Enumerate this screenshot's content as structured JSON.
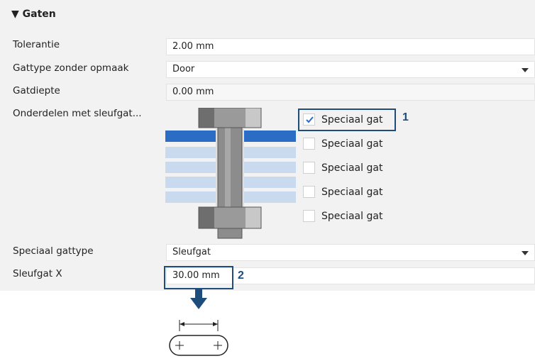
{
  "section": {
    "title": "▼ Gaten"
  },
  "rows": {
    "tolerance": {
      "label": "Tolerantie",
      "value": "2.00 mm"
    },
    "hole_type": {
      "label": "Gattype zonder opmaak",
      "value": "Door"
    },
    "hole_depth": {
      "label": "Gatdiepte",
      "value": "0.00 mm"
    },
    "slotted_parts": {
      "label": "Onderdelen met sleufgat..."
    },
    "special_hole_type": {
      "label": "Speciaal gattype",
      "value": "Sleufgat"
    },
    "slot_x": {
      "label": "Sleufgat X",
      "value": "30.00 mm"
    }
  },
  "checkboxes": [
    {
      "label": "Speciaal gat",
      "checked": true
    },
    {
      "label": "Speciaal gat",
      "checked": false
    },
    {
      "label": "Speciaal gat",
      "checked": false
    },
    {
      "label": "Speciaal gat",
      "checked": false
    },
    {
      "label": "Speciaal gat",
      "checked": false
    }
  ],
  "callouts": {
    "one": "1",
    "two": "2"
  },
  "colors": {
    "callout": "#1e4d7b",
    "plate_top": "#2b6cc4",
    "plate_layer": "#c9d9ee",
    "bolt": "#8a8a8a"
  }
}
